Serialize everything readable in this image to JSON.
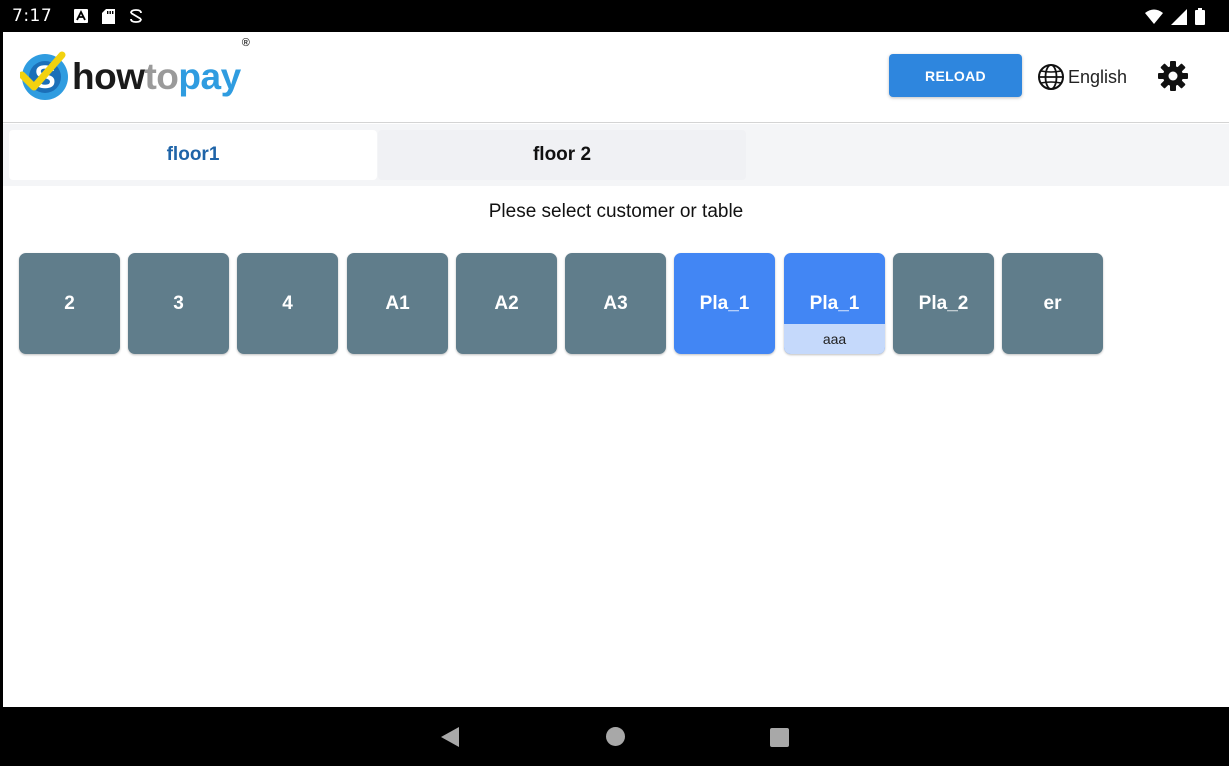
{
  "status_bar": {
    "time": "7:17",
    "left_icons": [
      "a-notification-icon",
      "sd-card-icon",
      "sync-icon"
    ],
    "right_icons": [
      "wifi-icon",
      "signal-icon",
      "battery-icon"
    ]
  },
  "header": {
    "logo": {
      "part1": "how",
      "part2": "to",
      "part3": "pay",
      "reg": "®"
    },
    "reload_label": "RELOAD",
    "language": "English"
  },
  "tabs": [
    {
      "label": "floor1",
      "active": true
    },
    {
      "label": "floor 2",
      "active": false
    }
  ],
  "prompt": "Plese select customer or table",
  "tables": [
    {
      "label": "2",
      "state": "free"
    },
    {
      "label": "3",
      "state": "free"
    },
    {
      "label": "4",
      "state": "free"
    },
    {
      "label": "A1",
      "state": "free"
    },
    {
      "label": "A2",
      "state": "free"
    },
    {
      "label": "A3",
      "state": "free"
    },
    {
      "label": "Pla_1",
      "state": "selected"
    },
    {
      "label": "Pla_1",
      "state": "occupied",
      "sub": "aaa"
    },
    {
      "label": "Pla_2",
      "state": "free"
    },
    {
      "label": "er",
      "state": "free"
    }
  ],
  "colors": {
    "tile_default": "#607d8b",
    "tile_blue": "#4286f4",
    "tile_sub_bg": "#c5d9fb",
    "reload_bg": "#2e86de",
    "tab_active_text": "#1f64a8"
  }
}
